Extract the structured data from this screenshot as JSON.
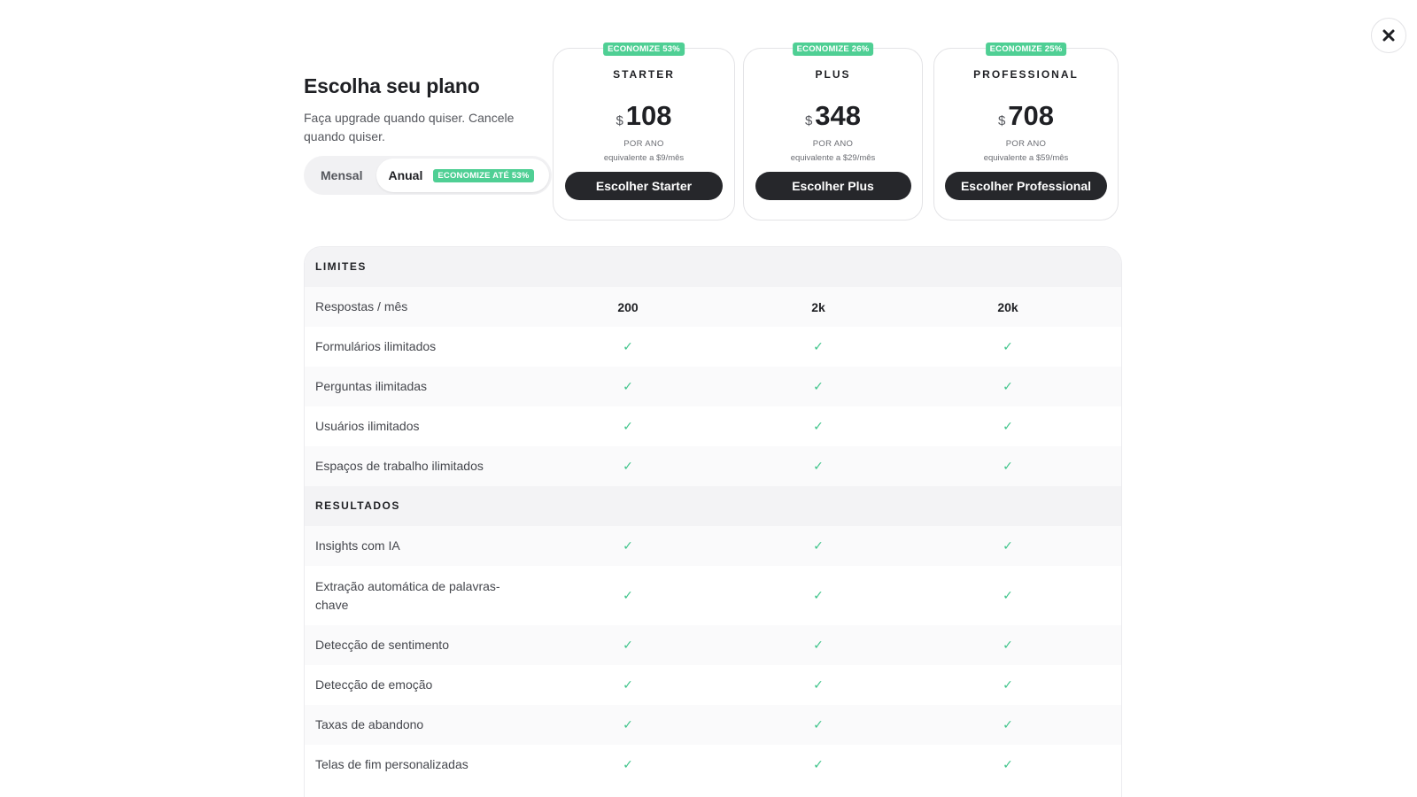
{
  "intro": {
    "title": "Escolha seu plano",
    "subtitle": "Faça upgrade quando quiser. Cancele quando quiser."
  },
  "billing": {
    "monthly_label": "Mensal",
    "annual_label": "Anual",
    "annual_badge": "ECONOMIZE ATÉ 53%",
    "selected": "Anual"
  },
  "plans": [
    {
      "badge": "ECONOMIZE 53%",
      "name": "STARTER",
      "currency": "$",
      "price": "108",
      "period": "POR ANO",
      "equivalent": "equivalente a $9/mês",
      "button": "Escolher Starter"
    },
    {
      "badge": "ECONOMIZE 26%",
      "name": "PLUS",
      "currency": "$",
      "price": "348",
      "period": "POR ANO",
      "equivalent": "equivalente a $29/mês",
      "button": "Escolher Plus"
    },
    {
      "badge": "ECONOMIZE 25%",
      "name": "PROFESSIONAL",
      "currency": "$",
      "price": "708",
      "period": "POR ANO",
      "equivalent": "equivalente a $59/mês",
      "button": "Escolher Professional"
    }
  ],
  "sections": [
    {
      "title": "LIMITES",
      "rows": [
        {
          "label": "Respostas / mês",
          "values": [
            "200",
            "2k",
            "20k"
          ]
        },
        {
          "label": "Formulários ilimitados",
          "values": [
            "✓",
            "✓",
            "✓"
          ]
        },
        {
          "label": "Perguntas ilimitadas",
          "values": [
            "✓",
            "✓",
            "✓"
          ]
        },
        {
          "label": "Usuários ilimitados",
          "values": [
            "✓",
            "✓",
            "✓"
          ]
        },
        {
          "label": "Espaços de trabalho ilimitados",
          "values": [
            "✓",
            "✓",
            "✓"
          ]
        }
      ]
    },
    {
      "title": "RESULTADOS",
      "rows": [
        {
          "label": "Insights com IA",
          "values": [
            "✓",
            "✓",
            "✓"
          ]
        },
        {
          "label": "Extração automática de palavras-chave",
          "values": [
            "✓",
            "✓",
            "✓"
          ]
        },
        {
          "label": "Detecção de sentimento",
          "values": [
            "✓",
            "✓",
            "✓"
          ]
        },
        {
          "label": "Detecção de emoção",
          "values": [
            "✓",
            "✓",
            "✓"
          ]
        },
        {
          "label": "Taxas de abandono",
          "values": [
            "✓",
            "✓",
            "✓"
          ]
        },
        {
          "label": "Telas de fim personalizadas",
          "values": [
            "✓",
            "✓",
            "✓"
          ]
        }
      ]
    }
  ],
  "icons": {
    "close": "close-icon",
    "check": "check-icon"
  },
  "colors": {
    "accent_green": "#4fcf94",
    "check_green": "#3ec48a",
    "button_dark": "#26272b"
  }
}
